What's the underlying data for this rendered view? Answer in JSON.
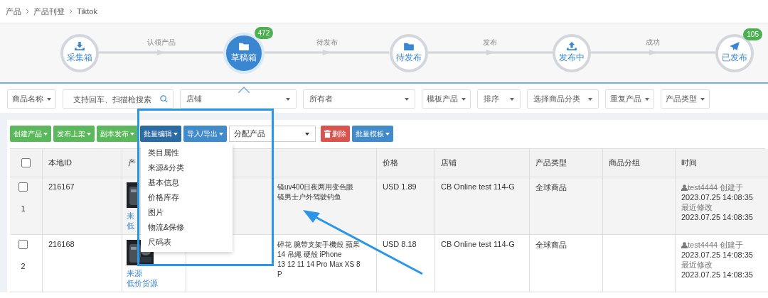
{
  "breadcrumb": [
    "产品",
    "产品刊登",
    "Tiktok"
  ],
  "steps": [
    {
      "label": "采集箱",
      "kind": "download",
      "selected": false
    },
    {
      "label": "草稿箱",
      "kind": "folder",
      "selected": true,
      "badge": "472"
    },
    {
      "label": "待发布",
      "kind": "folder",
      "selected": false
    },
    {
      "label": "发布中",
      "kind": "upload",
      "selected": false
    },
    {
      "label": "已发布",
      "kind": "plane",
      "selected": false,
      "badge": "105"
    }
  ],
  "connectors": [
    "认领产品",
    "待发布",
    "发布",
    "成功"
  ],
  "filters": [
    {
      "kind": "dropdown",
      "label": "商品名称"
    },
    {
      "kind": "search",
      "placeholder": "支持回车、扫描枪搜索"
    },
    {
      "kind": "select",
      "placeholder": "店铺"
    },
    {
      "kind": "select",
      "placeholder": "所有者"
    },
    {
      "kind": "dropdown",
      "label": "模板产品"
    },
    {
      "kind": "select",
      "placeholder": "排序"
    },
    {
      "kind": "select",
      "placeholder": "选择商品分类"
    },
    {
      "kind": "dropdown",
      "label": "重复产品"
    },
    {
      "kind": "dropdown",
      "label": "产品类型"
    }
  ],
  "actions": [
    {
      "kind": "success",
      "label": "创建产品",
      "expanded": false
    },
    {
      "kind": "success",
      "label": "发布上架",
      "expanded": false
    },
    {
      "kind": "success",
      "label": "副本发布",
      "expanded": false
    },
    {
      "kind": "primary",
      "label": "批量编辑",
      "expanded": true
    },
    {
      "kind": "primary",
      "label": "导入/导出",
      "expanded": false
    },
    {
      "kind": "select",
      "placeholder": "分配产品"
    },
    {
      "kind": "danger",
      "label": "删除"
    },
    {
      "kind": "primary",
      "label": "批量模板",
      "expanded": false
    }
  ],
  "menu": [
    "类目属性",
    "来源&分类",
    "基本信息",
    "价格库存",
    "图片",
    "物流&保修",
    "尺码表"
  ],
  "table": {
    "header_checked": false,
    "columns": [
      "本地ID",
      "产",
      "价格",
      "店铺",
      "产品类型",
      "商品分组",
      "时间"
    ],
    "rows": [
      {
        "checked": false,
        "number": "1",
        "id": "216167",
        "links": [
          "来",
          "低"
        ],
        "title_lines": [
          "镜uv400日夜两用变色眼镜男士户外驾驶钓鱼"
        ],
        "price": "USD 1.89",
        "shop": "CB Online test 114-G",
        "type": "全球商品",
        "user": "test4444",
        "created_label": "创建于",
        "created": "2023.07.25 14:08:35",
        "modified_label": "最近修改",
        "modified": "2023.07.25 14:08:35"
      },
      {
        "checked": false,
        "number": "2",
        "id": "216168",
        "links": [
          "来源",
          "低价货源"
        ],
        "title_lines": [
          "碎花 腕带支架手機殼 蘋果14 吊繩 硬殼 iPhone",
          "13 12 11 14 Pro Max XS 8P"
        ],
        "price": "USD 8.18",
        "shop": "CB Online test 114-G",
        "type": "全球商品",
        "user": "test4444",
        "created_label": "创建于",
        "created": "2023.07.25 14:08:35",
        "modified_label": "最近修改",
        "modified": "2023.07.25 14:08:35"
      }
    ]
  }
}
